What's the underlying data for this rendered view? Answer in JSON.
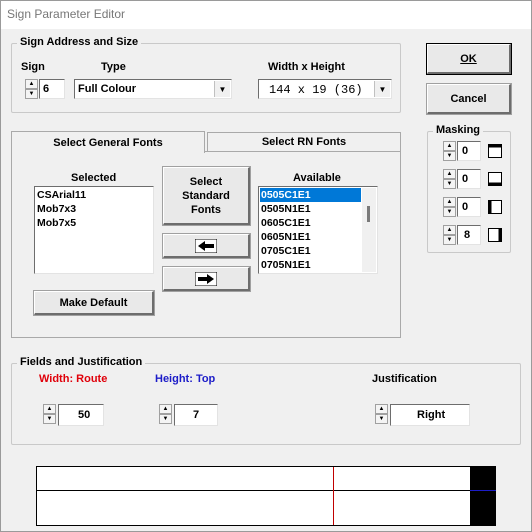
{
  "window": {
    "title": "Sign Parameter Editor"
  },
  "sign_address": {
    "group_label": "Sign Address and Size",
    "sign_label": "Sign",
    "sign_value": "6",
    "type_label": "Type",
    "type_value": "Full Colour",
    "wh_label": "Width x Height",
    "wh_value": "144 x 19 (36)"
  },
  "buttons": {
    "ok": "OK",
    "cancel": "Cancel"
  },
  "tabs": {
    "general": "Select General Fonts",
    "rn": "Select RN Fonts"
  },
  "fonts": {
    "selected_label": "Selected",
    "selected_items": [
      "CSArial11",
      "Mob7x3",
      "Mob7x5"
    ],
    "select_std_label": "Select Standard Fonts",
    "available_label": "Available",
    "available_items": [
      "0505C1E1",
      "0505N1E1",
      "0605C1E1",
      "0605N1E1",
      "0705C1E1",
      "0705N1E1"
    ],
    "make_default": "Make Default"
  },
  "masking": {
    "label": "Masking",
    "values": [
      "0",
      "0",
      "0",
      "8"
    ]
  },
  "fields": {
    "group_label": "Fields and Justification",
    "width_label": "Width: Route",
    "width_value": "50",
    "height_label": "Height: Top",
    "height_value": "7",
    "just_label": "Justification",
    "just_value": "Right"
  },
  "colors": {
    "width_label": "#e0000a",
    "height_label": "#1c1cc8",
    "selection": "#0078d7"
  }
}
